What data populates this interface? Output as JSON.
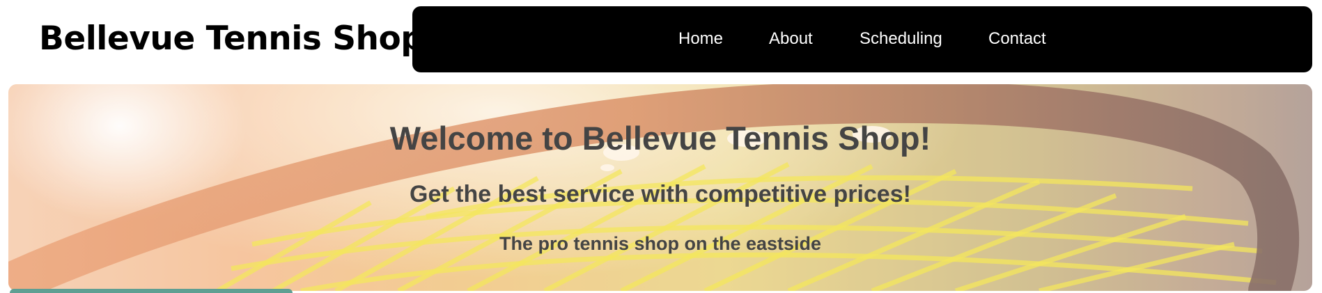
{
  "header": {
    "brand": "Bellevue Tennis Shop"
  },
  "nav": {
    "items": [
      {
        "label": "Home"
      },
      {
        "label": "About"
      },
      {
        "label": "Scheduling"
      },
      {
        "label": "Contact"
      }
    ]
  },
  "hero": {
    "title": "Welcome to Bellevue Tennis Shop!",
    "subtitle": "Get the best service with competitive prices!",
    "tagline": "The pro tennis shop on the eastside"
  },
  "colors": {
    "nav_background": "#000000",
    "nav_text": "#ffffff",
    "hero_text": "#444444",
    "section_accent": "#5f9f93"
  }
}
